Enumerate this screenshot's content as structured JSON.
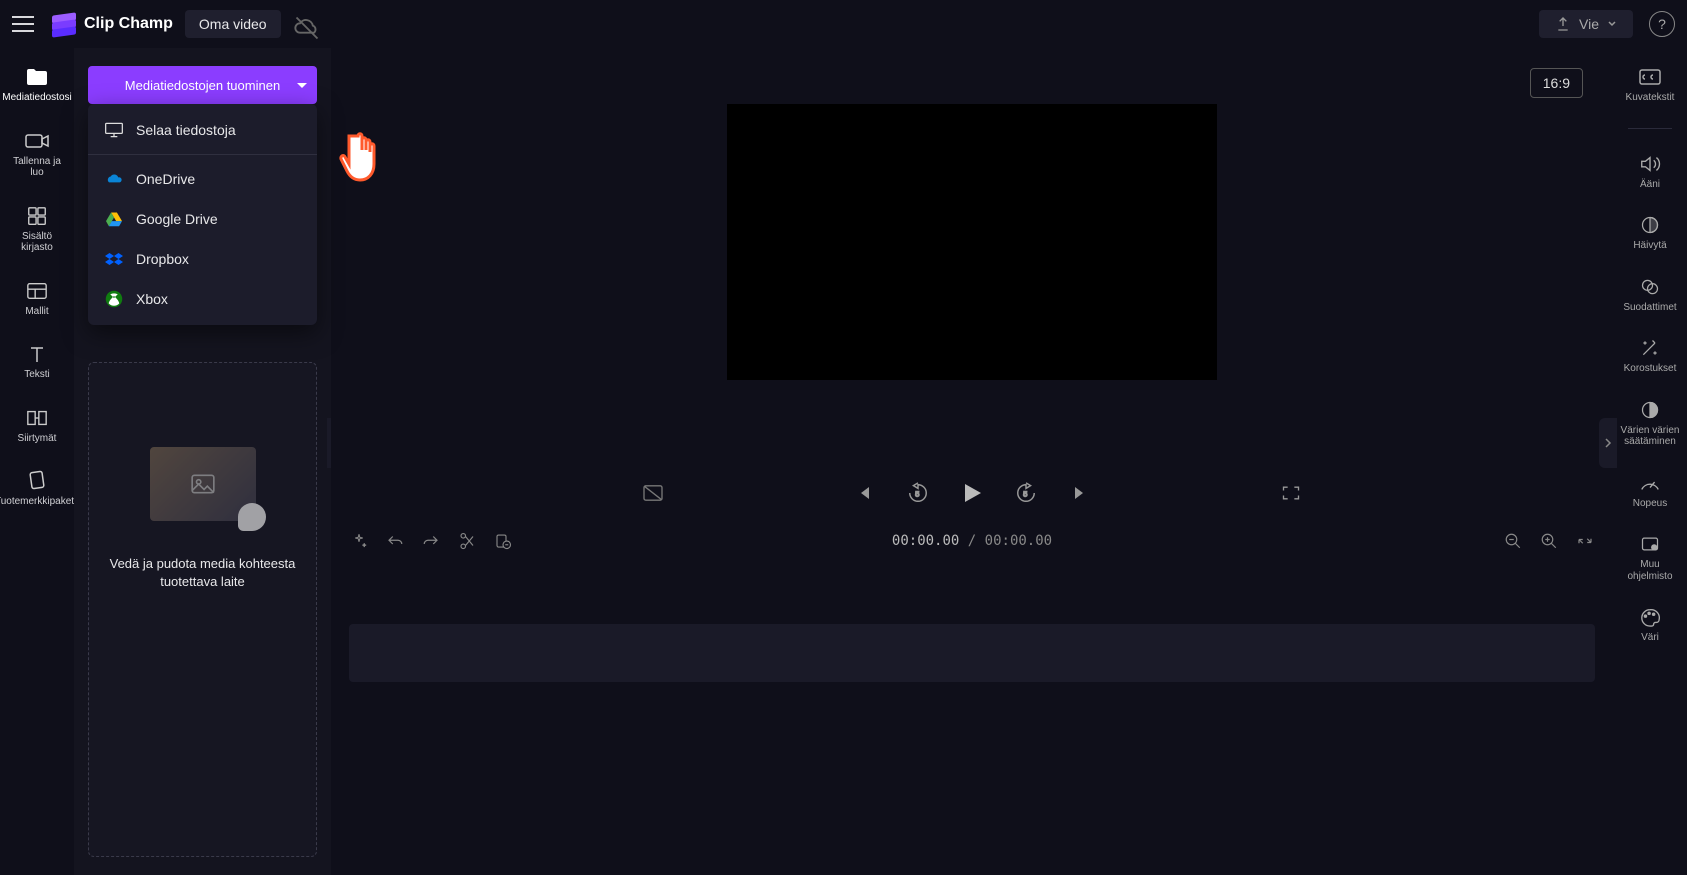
{
  "app_name": "Clip Champ",
  "project_title": "Oma video",
  "export_label": "Vie",
  "aspect_label": "16:9",
  "left_rail": [
    {
      "label": "Mediatiedostosi"
    },
    {
      "label": "Tallenna ja luo"
    },
    {
      "label": "Sisältö kirjasto"
    },
    {
      "label": "Mallit"
    },
    {
      "label": "Teksti"
    },
    {
      "label": "Siirtymät"
    },
    {
      "label": "Tuotemerkkipaketti"
    }
  ],
  "import_button": "Mediatiedostojen tuominen",
  "import_dropdown": {
    "browse": "Selaa tiedostoja",
    "onedrive": "OneDrive",
    "gdrive": "Google Drive",
    "dropbox": "Dropbox",
    "xbox": "Xbox"
  },
  "dropzone_text": "Vedä ja pudota media kohteesta tuotettava laite",
  "timecode": {
    "current": "00:00.00",
    "separator": "/",
    "total": "00:00.00"
  },
  "right_rail": [
    {
      "label": "Kuvatekstit"
    },
    {
      "label": "Ääni"
    },
    {
      "label": "Häivytä"
    },
    {
      "label": "Suodattimet"
    },
    {
      "label": "Korostukset"
    },
    {
      "label": "Värien värien säätäminen"
    },
    {
      "label": "Nopeus"
    },
    {
      "label": "Muu ohjelmisto"
    },
    {
      "label": "Väri"
    }
  ]
}
